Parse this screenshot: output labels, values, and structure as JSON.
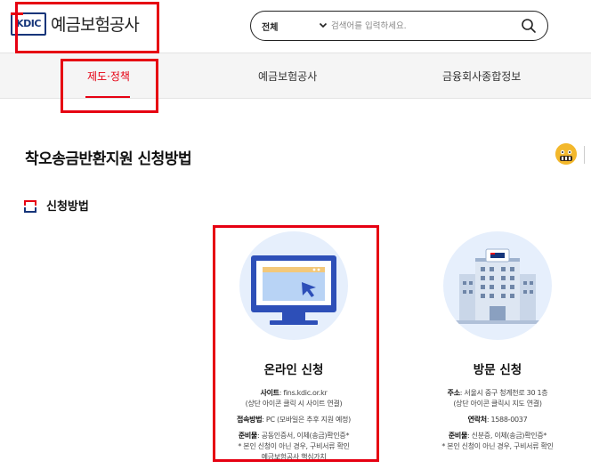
{
  "header": {
    "logo_mark": "KDIC",
    "logo_name": "예금보험공사",
    "search": {
      "category": "전체",
      "placeholder": "검색어를 입력하세요."
    }
  },
  "nav": {
    "items": [
      {
        "label": "제도·정책",
        "active": true
      },
      {
        "label": "예금보험공사",
        "active": false
      },
      {
        "label": "금융회사종합정보",
        "active": false
      }
    ]
  },
  "page": {
    "title": "착오송금반환지원 신청방법",
    "section_title": "신청방법"
  },
  "cards": [
    {
      "title": "온라인 신청",
      "rows": [
        {
          "label": "사이트",
          "text": ": fins.kdic.or.kr"
        },
        {
          "label": "",
          "text": "(상단 아이콘 클릭 시 사이트 연결)"
        },
        {
          "label": "접속방법",
          "text": ": PC (모바일은 추후 지원 예정)"
        },
        {
          "label": "준비물",
          "text": ": 공동인증서, 이체(송금)확인증*"
        },
        {
          "label": "",
          "text": "* 본인 신청이 아닌 경우, 구비서류 확인"
        },
        {
          "label": "",
          "text": "예금보험공사 핵심가치"
        }
      ]
    },
    {
      "title": "방문 신청",
      "rows": [
        {
          "label": "주소",
          "text": ": 서울시 중구 청계천로 30 1층"
        },
        {
          "label": "",
          "text": "(상단 아이콘 클릭시 지도 연결)"
        },
        {
          "label": "연락처",
          "text": ": 1588-0037"
        },
        {
          "label": "준비물",
          "text": ": 신분증, 이체(송금)확인증*"
        },
        {
          "label": "",
          "text": "* 본인 신청이 아닌 경우, 구비서류 확인"
        }
      ]
    }
  ],
  "colors": {
    "accent": "#e60012",
    "brand": "#16357a",
    "monitor": "#2d4fb8",
    "circle_bg": "#e6effc"
  }
}
